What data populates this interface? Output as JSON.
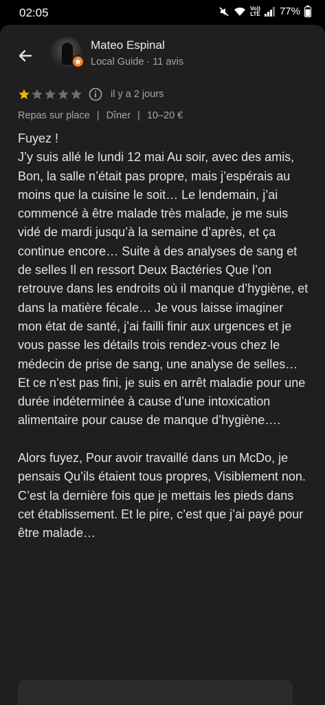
{
  "status_bar": {
    "time": "02:05",
    "lte_top": "Vo))",
    "lte_bottom": "LTE",
    "battery": "77%"
  },
  "header": {
    "back_icon": "arrow-back-icon",
    "author_name": "Mateo Espinal",
    "author_meta": "Local Guide · 11 avis",
    "badge_icon": "local-guide-badge-icon",
    "badge_color": "#f37c23"
  },
  "review": {
    "rating": 1,
    "max_rating": 5,
    "star_filled_color": "#f6b400",
    "star_empty_color": "#6f6f6f",
    "date": "il y a 2 jours",
    "tags": [
      "Repas sur place",
      "Dîner",
      "10–20 €"
    ],
    "tag_separator": "|",
    "text": "Fuyez !\nJ’y suis allé le lundi 12 mai Au soir, avec des amis, Bon, la salle n’était pas propre, mais j’espérais au moins que la cuisine le soit… Le lendemain, j’ai commencé à être malade très malade, je me suis vidé de mardi jusqu’à la semaine d’après, et ça continue encore… Suite à des analyses de sang et de selles Il en ressort Deux Bactéries Que l’on retrouve dans les endroits où il manque d’hygiène, et dans la matière fécale… Je vous laisse imaginer mon état de santé, j’ai failli finir aux urgences et je vous passe les détails trois rendez-vous chez le médecin de prise de sang, une analyse de selles… Et ce n’est pas fini, je suis en arrêt maladie pour une durée indéterminée à cause d’une intoxication alimentaire pour cause de manque d’hygiène….\n\nAlors fuyez, Pour avoir travaillé dans un McDo, je pensais Qu’ils étaient tous propres, Visiblement non.\nC’est la dernière fois que je mettais les pieds dans cet établissement. Et le pire, c’est que j’ai payé pour être malade…"
  }
}
